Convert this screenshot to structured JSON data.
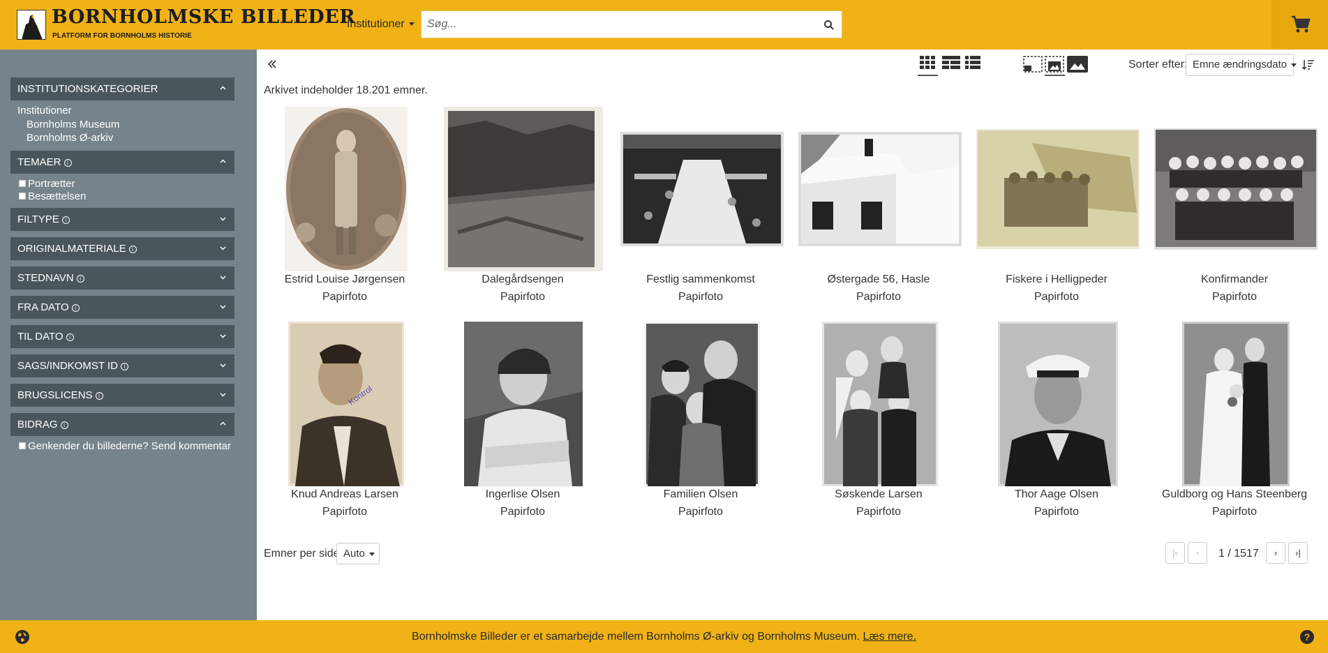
{
  "header": {
    "title": "BORNHOLMSKE BILLEDER",
    "subtitle": "PLATFORM FOR BORNHOLMS HISTORIE",
    "institutions_label": "Institutioner",
    "search_placeholder": "Søg...",
    "brand_color": "#f0b217"
  },
  "sidebar": {
    "facets": {
      "institutionskategorier": "INSTITUTIONSKATEGORIER",
      "temaer": "TEMAER",
      "filtype": "FILTYPE",
      "originalmateriale": "ORIGINALMATERIALE",
      "stednavn": "STEDNAVN",
      "fra_dato": "FRA DATO",
      "til_dato": "TIL DATO",
      "sags_id": "SAGS/INDKOMST ID",
      "brugslicens": "BRUGSLICENS",
      "bidrag": "BIDRAG"
    },
    "institutions": {
      "group": "Institutioner",
      "items": [
        "Bornholms Museum",
        "Bornholms Ø-arkiv"
      ]
    },
    "temaer_items": [
      "Portrætter",
      "Besættelsen"
    ],
    "bidrag_items": [
      "Genkender du billederne? Send kommentar"
    ]
  },
  "toolbar": {
    "sort_label": "Sorter efter:",
    "sort_value": "Emne ændringsdato",
    "icons": [
      "grid-view-icon",
      "list-gallery-view-icon",
      "list-view-icon",
      "small-image-icon",
      "medium-image-icon",
      "large-image-icon",
      "sort-order-icon"
    ]
  },
  "archive_count_text": "Arkivet indeholder 18.201 emner.",
  "items": [
    {
      "title": "Estrid Louise Jørgensen",
      "type": "Papirfoto"
    },
    {
      "title": "Dalegårdsengen",
      "type": "Papirfoto"
    },
    {
      "title": "Festlig sammenkomst",
      "type": "Papirfoto"
    },
    {
      "title": "Østergade 56, Hasle",
      "type": "Papirfoto"
    },
    {
      "title": "Fiskere i Helligpeder",
      "type": "Papirfoto"
    },
    {
      "title": "Konfirmander",
      "type": "Papirfoto"
    },
    {
      "title": "Knud Andreas Larsen",
      "type": "Papirfoto"
    },
    {
      "title": "Ingerlise Olsen",
      "type": "Papirfoto"
    },
    {
      "title": "Familien Olsen",
      "type": "Papirfoto"
    },
    {
      "title": "Søskende Larsen",
      "type": "Papirfoto"
    },
    {
      "title": "Thor Aage Olsen",
      "type": "Papirfoto"
    },
    {
      "title": "Guldborg og Hans Steenberg",
      "type": "Papirfoto"
    }
  ],
  "pagination": {
    "per_page_label": "Emner per side:",
    "per_page_value": "Auto",
    "first": "|‹",
    "prev": "‹",
    "next": "›",
    "last": "›|",
    "page_text": "1 / 1517"
  },
  "footer": {
    "text": "Bornholmske Billeder er et samarbejde mellem Bornholms Ø-arkiv og Bornholms Museum.",
    "link": "Læs mere."
  }
}
